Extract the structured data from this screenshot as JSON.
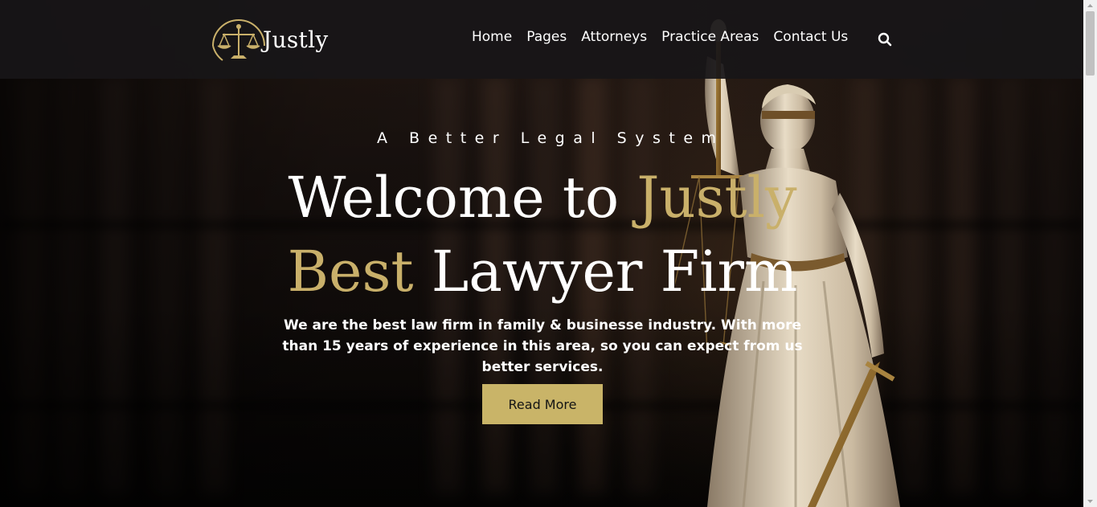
{
  "brand": {
    "name": "Justly"
  },
  "nav": {
    "items": [
      {
        "label": "Home"
      },
      {
        "label": "Pages"
      },
      {
        "label": "Attorneys"
      },
      {
        "label": "Practice Areas"
      },
      {
        "label": "Contact Us"
      }
    ],
    "search_icon": "search-icon"
  },
  "hero": {
    "tagline": "A Better Legal System",
    "title_line1_white": "Welcome to ",
    "title_line1_gold": "Justly",
    "title_line2_gold": "Best",
    "title_line2_white": " Lawyer Firm",
    "description": "We are the best law firm in family & businesse industry. With more than 15 years of experience in this area, so you can expect from us better services.",
    "cta_label": "Read More"
  },
  "colors": {
    "accent_gold": "#c9b06a",
    "button_gold": "#c9b468",
    "header_bg": "#181618",
    "text_white": "#ffffff"
  }
}
